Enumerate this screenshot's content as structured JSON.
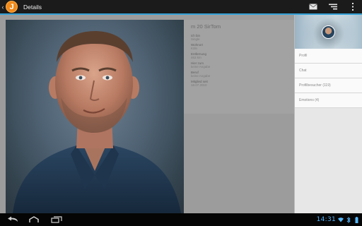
{
  "actionbar": {
    "up_glyph": "‹",
    "app_icon_letter": "J",
    "title": "Details",
    "icons": [
      "mail-icon",
      "filter-icon",
      "overflow-menu-icon"
    ]
  },
  "profile": {
    "name": "m 20 SirTom",
    "fields": [
      {
        "label": "ich bin",
        "value": "Single"
      },
      {
        "label": "Wohnort",
        "value": "Köln"
      },
      {
        "label": "Entfernung",
        "value": "463 km"
      },
      {
        "label": "Hier zum",
        "value": "keine Angabe"
      },
      {
        "label": "Beruf",
        "value": "keine Angabe"
      },
      {
        "label": "Mitglied seit",
        "value": "18.07.2010"
      }
    ]
  },
  "side_menu": {
    "items": [
      {
        "label": "Profil"
      },
      {
        "label": "Chat"
      },
      {
        "label": "Profilbesucher (119)"
      },
      {
        "label": "Emotions (4)"
      }
    ]
  },
  "navbar": {
    "clock": "14:31",
    "buttons": [
      "back-icon",
      "home-icon",
      "recent-apps-icon"
    ]
  },
  "colors": {
    "accent": "#33a0d6",
    "app_icon": "#f08a1b",
    "clock": "#55b8ff"
  }
}
